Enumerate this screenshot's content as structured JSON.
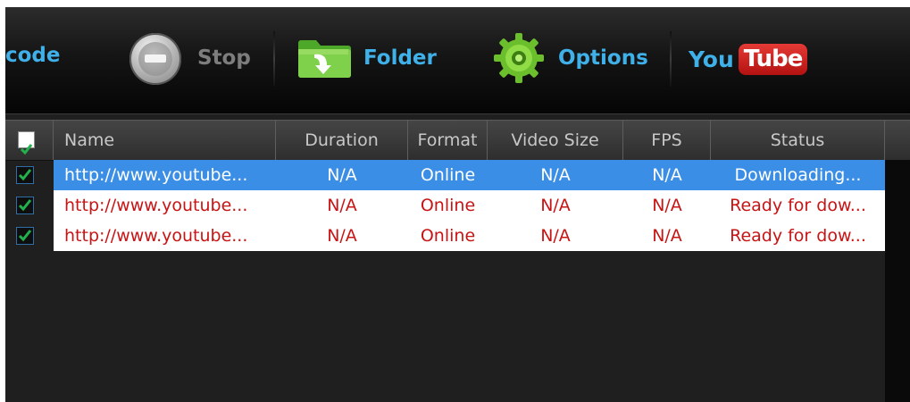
{
  "toolbar": {
    "encode_label": "code",
    "stop_label": "Stop",
    "folder_label": "Folder",
    "options_label": "Options",
    "youtube": {
      "you": "You",
      "tube": "Tube"
    }
  },
  "icons": {
    "stop": "stop-circle-icon",
    "folder": "folder-arrow-icon",
    "options": "gear-icon",
    "checkbox": "checkmark-icon"
  },
  "colors": {
    "accent": "#3fb0e8",
    "selected_row": "#3a8ee6",
    "status_text": "#c81414",
    "check": "#22b14c"
  },
  "table": {
    "columns": [
      "Name",
      "Duration",
      "Format",
      "Video Size",
      "FPS",
      "Status"
    ],
    "rows": [
      {
        "name": "http://www.youtube...",
        "duration": "N/A",
        "format": "Online",
        "video_size": "N/A",
        "fps": "N/A",
        "status": "Downloading...",
        "checked": true,
        "selected": true
      },
      {
        "name": "http://www.youtube...",
        "duration": "N/A",
        "format": "Online",
        "video_size": "N/A",
        "fps": "N/A",
        "status": "Ready for dow...",
        "checked": true,
        "selected": false
      },
      {
        "name": "http://www.youtube...",
        "duration": "N/A",
        "format": "Online",
        "video_size": "N/A",
        "fps": "N/A",
        "status": "Ready for dow...",
        "checked": true,
        "selected": false
      }
    ]
  }
}
